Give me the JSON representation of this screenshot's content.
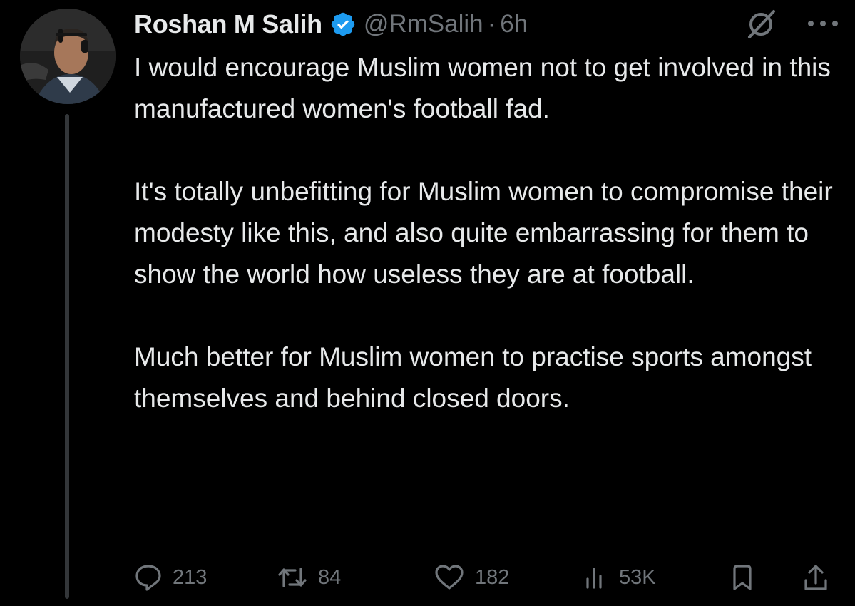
{
  "author": {
    "display_name": "Roshan M Salih",
    "handle": "@RmSalih",
    "separator": "·",
    "time": "6h",
    "verified": true
  },
  "tweet": {
    "paragraphs": [
      "I would encourage Muslim women not to get involved in this manufactured women's football fad.",
      "It's totally unbefitting for Muslim women to compromise their modesty like this, and also quite embarrassing for them to show the world how useless they are at football.",
      "Much better for Muslim women to practise sports amongst themselves and behind closed doors."
    ]
  },
  "metrics": {
    "replies": "213",
    "reposts": "84",
    "likes": "182",
    "views": "53K"
  },
  "icons": {
    "verified": "verified-badge-icon",
    "grok": "grok-icon",
    "more": "more-icon",
    "reply": "reply-icon",
    "repost": "repost-icon",
    "like": "like-icon",
    "views": "views-icon",
    "bookmark": "bookmark-icon",
    "share": "share-icon"
  },
  "colors": {
    "background": "#000000",
    "text": "#e7e9ea",
    "secondary": "#71767b",
    "verified": "#1d9bf0"
  }
}
